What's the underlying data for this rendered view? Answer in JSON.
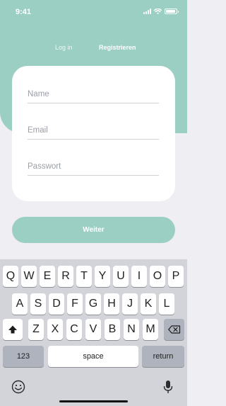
{
  "status_bar": {
    "time": "9:41"
  },
  "tabs": {
    "login": "Log in",
    "register": "Registrieren"
  },
  "form": {
    "name_placeholder": "Name",
    "email_placeholder": "Email",
    "password_placeholder": "Passwort"
  },
  "submit_label": "Weiter",
  "keyboard": {
    "row1": [
      "Q",
      "W",
      "E",
      "R",
      "T",
      "Y",
      "U",
      "I",
      "O",
      "P"
    ],
    "row2": [
      "A",
      "S",
      "D",
      "F",
      "G",
      "H",
      "J",
      "K",
      "L"
    ],
    "row3": [
      "Z",
      "X",
      "C",
      "V",
      "B",
      "N",
      "M"
    ],
    "numbers_label": "123",
    "space_label": "space",
    "return_label": "return",
    "icons": {
      "shift": "shift-icon",
      "delete": "backspace-icon",
      "emoji": "emoji-icon",
      "mic": "microphone-icon"
    }
  },
  "colors": {
    "accent": "#9ccfc3",
    "background": "#efeef2",
    "keyboard": "#d2d4da"
  }
}
